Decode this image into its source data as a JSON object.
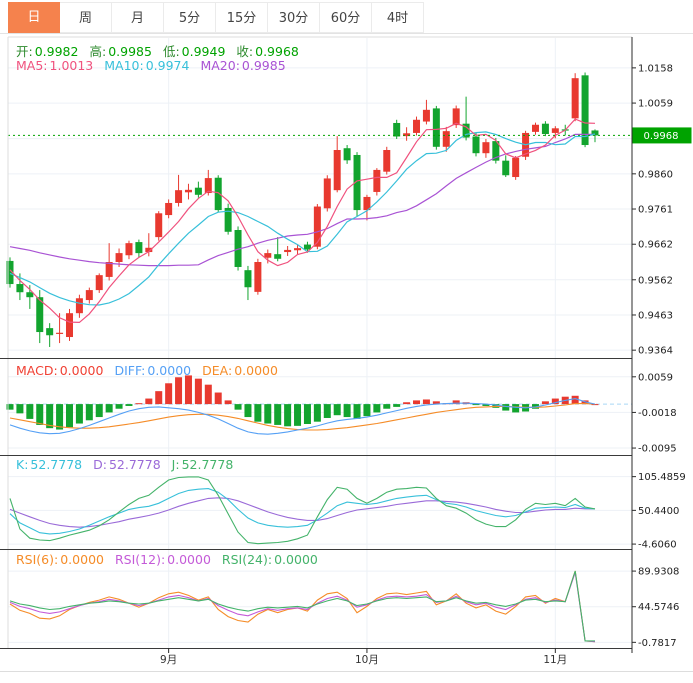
{
  "tabbar": {
    "selected_color": "#f5824d",
    "tabs": [
      {
        "label": "日",
        "name": "tab-day",
        "selected": true
      },
      {
        "label": "周",
        "name": "tab-week",
        "selected": false
      },
      {
        "label": "月",
        "name": "tab-month",
        "selected": false
      },
      {
        "label": "5分",
        "name": "tab-5min",
        "selected": false
      },
      {
        "label": "15分",
        "name": "tab-15min",
        "selected": false
      },
      {
        "label": "30分",
        "name": "tab-30min",
        "selected": false
      },
      {
        "label": "60分",
        "name": "tab-60min",
        "selected": false
      },
      {
        "label": "4时",
        "name": "tab-4hour",
        "selected": false
      }
    ]
  },
  "indicators": {
    "ohlc": {
      "items": [
        {
          "label": "开:",
          "value": "0.9982",
          "color": "#00a300",
          "label_color": "#2e8b2e"
        },
        {
          "label": "高:",
          "value": "0.9985",
          "color": "#00a300",
          "label_color": "#2e8b2e"
        },
        {
          "label": "低:",
          "value": "0.9949",
          "color": "#00a300",
          "label_color": "#2e8b2e"
        },
        {
          "label": "收:",
          "value": "0.9968",
          "color": "#00a300",
          "label_color": "#2e8b2e"
        }
      ]
    },
    "ma": {
      "items": [
        {
          "label": "MA5:",
          "value": "1.0013",
          "color": "#f0527e"
        },
        {
          "label": "MA10:",
          "value": "0.9974",
          "color": "#38c0da"
        },
        {
          "label": "MA20:",
          "value": "0.9985",
          "color": "#a953d4"
        }
      ]
    },
    "macd": {
      "items": [
        {
          "label": "MACD:",
          "value": "0.0000",
          "color": "#f04134"
        },
        {
          "label": "DIFF:",
          "value": "0.0000",
          "color": "#55a0f5"
        },
        {
          "label": "DEA:",
          "value": "0.0000",
          "color": "#f58c28"
        }
      ]
    },
    "kdj": {
      "items": [
        {
          "label": "K:",
          "value": "52.7778",
          "color": "#38c0da"
        },
        {
          "label": "D:",
          "value": "52.7778",
          "color": "#9a6ad8"
        },
        {
          "label": "J:",
          "value": "52.7778",
          "color": "#44b36a"
        }
      ]
    },
    "rsi": {
      "items": [
        {
          "label": "RSI(6):",
          "value": "0.0000",
          "color": "#f58c28"
        },
        {
          "label": "RSI(12):",
          "value": "0.0000",
          "color": "#c45bd8"
        },
        {
          "label": "RSI(24):",
          "value": "0.0000",
          "color": "#44b36a"
        }
      ]
    }
  },
  "chart_data": {
    "type": "candlestick+indicators",
    "x_labels": [
      {
        "index": 16,
        "label": "9月"
      },
      {
        "index": 36,
        "label": "10月"
      },
      {
        "index": 55,
        "label": "11月"
      }
    ],
    "current_price": {
      "value": 0.9968,
      "label": "0.9968"
    },
    "colors": {
      "up": "#e8392f",
      "down": "#12a42e",
      "ma5": "#f0527e",
      "ma10": "#38c0da",
      "ma20": "#a953d4",
      "diff": "#55a0f5",
      "dea": "#f58c28",
      "k": "#38c0da",
      "d": "#9a6ad8",
      "j": "#44b36a",
      "rsi6": "#f58c28",
      "rsi12": "#c45bd8",
      "rsi24": "#44b36a",
      "badge": "#00a300",
      "grid": "#edf1f6",
      "axis": "#2b2b2b",
      "zero_dash": "#a9d6f5",
      "sep": "#3a3a3a"
    },
    "panes": {
      "price": {
        "yticks": [
          "1.0158",
          "1.0059",
          "0.9860",
          "0.9761",
          "0.9662",
          "0.9562",
          "0.9463",
          "0.9364"
        ],
        "grid_extra": [
          0.9959
        ],
        "ylim": [
          0.9342,
          1.0242
        ]
      },
      "macd": {
        "yticks": [
          "0.0059",
          "-0.0018",
          "-0.0095"
        ],
        "ylim": [
          -0.011,
          0.0091
        ],
        "zero_line": true
      },
      "kdj": {
        "yticks": [
          "105.4859",
          "50.4400",
          "-4.6060"
        ],
        "ylim": [
          -11.0,
          135.9
        ]
      },
      "rsi": {
        "yticks": [
          "89.9308",
          "44.5746",
          "-0.7817"
        ],
        "ylim": [
          -8.0,
          115.5
        ]
      }
    },
    "candles": [
      [
        0.9615,
        0.9625,
        0.954,
        0.955
      ],
      [
        0.955,
        0.958,
        0.9505,
        0.9527
      ],
      [
        0.9527,
        0.9547,
        0.948,
        0.9513
      ],
      [
        0.9513,
        0.9533,
        0.9384,
        0.9415
      ],
      [
        0.9426,
        0.944,
        0.9373,
        0.9406
      ],
      [
        0.9412,
        0.9468,
        0.9384,
        0.9413
      ],
      [
        0.9401,
        0.948,
        0.939,
        0.9468
      ],
      [
        0.9468,
        0.952,
        0.9455,
        0.951
      ],
      [
        0.9505,
        0.954,
        0.9495,
        0.9533
      ],
      [
        0.9533,
        0.958,
        0.9525,
        0.9575
      ],
      [
        0.957,
        0.9665,
        0.956,
        0.9612
      ],
      [
        0.9612,
        0.965,
        0.9598,
        0.9637
      ],
      [
        0.9631,
        0.9672,
        0.962,
        0.9665
      ],
      [
        0.9668,
        0.9675,
        0.9625,
        0.9637
      ],
      [
        0.964,
        0.9693,
        0.9628,
        0.9652
      ],
      [
        0.9682,
        0.9755,
        0.9672,
        0.9749
      ],
      [
        0.9744,
        0.9788,
        0.9735,
        0.9778
      ],
      [
        0.9778,
        0.9857,
        0.9768,
        0.9814
      ],
      [
        0.9808,
        0.9832,
        0.9788,
        0.9815
      ],
      [
        0.9821,
        0.9838,
        0.9793,
        0.9801
      ],
      [
        0.9806,
        0.9871,
        0.9799,
        0.9848
      ],
      [
        0.9849,
        0.9856,
        0.9752,
        0.9758
      ],
      [
        0.9764,
        0.9776,
        0.9689,
        0.9697
      ],
      [
        0.9702,
        0.9712,
        0.9588,
        0.9598
      ],
      [
        0.9589,
        0.9601,
        0.9505,
        0.9541
      ],
      [
        0.9528,
        0.9621,
        0.952,
        0.9612
      ],
      [
        0.9624,
        0.9647,
        0.9608,
        0.9637
      ],
      [
        0.9634,
        0.9682,
        0.9614,
        0.9621
      ],
      [
        0.964,
        0.9657,
        0.9629,
        0.9646
      ],
      [
        0.9645,
        0.9662,
        0.9634,
        0.9651
      ],
      [
        0.9661,
        0.9669,
        0.9638,
        0.9647
      ],
      [
        0.9655,
        0.9775,
        0.9648,
        0.9768
      ],
      [
        0.9763,
        0.9856,
        0.9754,
        0.9847
      ],
      [
        0.9814,
        0.9966,
        0.9808,
        0.9927
      ],
      [
        0.9932,
        0.9941,
        0.9888,
        0.9898
      ],
      [
        0.9913,
        0.9921,
        0.9739,
        0.9758
      ],
      [
        0.9758,
        0.9801,
        0.9729,
        0.9795
      ],
      [
        0.9809,
        0.9876,
        0.9799,
        0.9871
      ],
      [
        0.9866,
        0.9936,
        0.9858,
        0.9927
      ],
      [
        1.0003,
        1.0012,
        0.9958,
        0.9965
      ],
      [
        0.9966,
        0.9991,
        0.9953,
        0.9974
      ],
      [
        0.9975,
        1.0021,
        0.9968,
        1.0012
      ],
      [
        1.0007,
        1.0068,
        0.9999,
        1.004
      ],
      [
        1.0044,
        1.0051,
        0.9928,
        0.9936
      ],
      [
        0.9936,
        0.9992,
        0.9922,
        0.998
      ],
      [
        0.9997,
        1.0052,
        0.9989,
        1.0044
      ],
      [
        1.0001,
        1.0077,
        0.9954,
        0.9962
      ],
      [
        0.9965,
        0.9976,
        0.9909,
        0.9918
      ],
      [
        0.9918,
        0.9958,
        0.9905,
        0.9949
      ],
      [
        0.9952,
        0.9961,
        0.9889,
        0.9897
      ],
      [
        0.9897,
        0.9912,
        0.9851,
        0.9856
      ],
      [
        0.9851,
        0.991,
        0.9843,
        0.9905
      ],
      [
        0.9908,
        0.9981,
        0.9899,
        0.9975
      ],
      [
        0.9978,
        1.0004,
        0.997,
        0.9998
      ],
      [
        1.0001,
        1.0008,
        0.9966,
        0.9972
      ],
      [
        0.9975,
        0.9994,
        0.996,
        0.9988
      ],
      [
        0.9985,
        0.9998,
        0.9968,
        0.9984
      ],
      [
        1.0016,
        1.0143,
        1.0008,
        1.0129
      ],
      [
        1.0137,
        1.0145,
        0.9935,
        0.9941
      ],
      [
        0.9982,
        0.9985,
        0.9949,
        0.9968
      ]
    ],
    "series": {
      "ma5": [
        0.959,
        0.956,
        0.9535,
        0.9505,
        0.9482,
        0.9455,
        0.9443,
        0.9442,
        0.9466,
        0.95,
        0.954,
        0.9573,
        0.9604,
        0.9625,
        0.9641,
        0.9668,
        0.9696,
        0.9726,
        0.9762,
        0.9791,
        0.9811,
        0.9807,
        0.9784,
        0.974,
        0.9688,
        0.9641,
        0.9617,
        0.9602,
        0.9611,
        0.9633,
        0.964,
        0.9667,
        0.9712,
        0.9768,
        0.9817,
        0.984,
        0.9845,
        0.985,
        0.985,
        0.9863,
        0.9906,
        0.995,
        0.9984,
        0.9985,
        0.9988,
        1.0002,
        0.9992,
        0.9968,
        0.9971,
        0.9954,
        0.9916,
        0.9905,
        0.9916,
        0.9926,
        0.9941,
        0.9968,
        0.9983,
        1.0014,
        1.0003,
        1.0002
      ],
      "ma10": [
        0.958,
        0.9568,
        0.9556,
        0.954,
        0.9524,
        0.9512,
        0.9503,
        0.9496,
        0.9492,
        0.9491,
        0.9497,
        0.9508,
        0.9523,
        0.9546,
        0.957,
        0.9604,
        0.9635,
        0.9665,
        0.9693,
        0.9716,
        0.974,
        0.9752,
        0.9755,
        0.9751,
        0.974,
        0.9726,
        0.9712,
        0.9693,
        0.9676,
        0.9661,
        0.9641,
        0.9642,
        0.9657,
        0.969,
        0.9725,
        0.974,
        0.9756,
        0.9781,
        0.9809,
        0.984,
        0.9873,
        0.9897,
        0.9917,
        0.9918,
        0.9926,
        0.9954,
        0.9971,
        0.9976,
        0.9978,
        0.9971,
        0.9959,
        0.9949,
        0.9942,
        0.9948,
        0.9948,
        0.9942,
        0.9944,
        0.9965,
        0.9965,
        0.9972
      ],
      "ma20": [
        0.9655,
        0.965,
        0.9645,
        0.9638,
        0.9632,
        0.9626,
        0.9621,
        0.9617,
        0.9613,
        0.961,
        0.9608,
        0.9606,
        0.9604,
        0.9603,
        0.9602,
        0.9602,
        0.9602,
        0.9603,
        0.9603,
        0.9604,
        0.9618,
        0.963,
        0.9639,
        0.9648,
        0.9655,
        0.9665,
        0.9673,
        0.9679,
        0.9685,
        0.9688,
        0.969,
        0.9697,
        0.9706,
        0.972,
        0.9733,
        0.9733,
        0.9734,
        0.9737,
        0.9742,
        0.9751,
        0.9757,
        0.977,
        0.9787,
        0.9804,
        0.9826,
        0.9847,
        0.9863,
        0.9878,
        0.9893,
        0.9906,
        0.9916,
        0.9923,
        0.9929,
        0.9933,
        0.9937,
        0.9948,
        0.9958,
        0.9971,
        0.9971,
        0.9971
      ],
      "macd_hist": [
        -0.0012,
        -0.002,
        -0.0032,
        -0.0045,
        -0.0052,
        -0.0055,
        -0.005,
        -0.0042,
        -0.0035,
        -0.0028,
        -0.0018,
        -0.001,
        -0.0004,
        0.0002,
        0.0012,
        0.0028,
        0.0045,
        0.0058,
        0.0062,
        0.0055,
        0.0042,
        0.0025,
        0.0008,
        -0.0012,
        -0.0028,
        -0.0038,
        -0.0042,
        -0.0045,
        -0.0048,
        -0.0047,
        -0.0043,
        -0.0038,
        -0.003,
        -0.0024,
        -0.0028,
        -0.0032,
        -0.0026,
        -0.0018,
        -0.001,
        -0.0006,
        0.0004,
        0.0008,
        0.001,
        0.0006,
        0.0002,
        0.0008,
        0.0004,
        -0.0002,
        -0.0004,
        -0.0008,
        -0.0014,
        -0.0018,
        -0.0016,
        -0.001,
        0.0006,
        0.0012,
        0.0016,
        0.0018,
        0.0008,
        0.0
      ],
      "diff": [
        -0.0045,
        -0.0052,
        -0.0058,
        -0.0062,
        -0.0064,
        -0.0063,
        -0.0059,
        -0.0053,
        -0.0046,
        -0.0038,
        -0.003,
        -0.0022,
        -0.0015,
        -0.001,
        -0.0007,
        -0.0006,
        -0.0008,
        -0.001,
        -0.0013,
        -0.0018,
        -0.0024,
        -0.0032,
        -0.0042,
        -0.0052,
        -0.006,
        -0.0064,
        -0.0065,
        -0.0063,
        -0.006,
        -0.0056,
        -0.0052,
        -0.0047,
        -0.0041,
        -0.0036,
        -0.0033,
        -0.0031,
        -0.0028,
        -0.0024,
        -0.0019,
        -0.0014,
        -0.0009,
        -0.0005,
        -0.0002,
        0.0,
        0.0001,
        0.0002,
        0.0002,
        0.0001,
        0.0,
        -0.0002,
        -0.0005,
        -0.0007,
        -0.0008,
        -0.0006,
        -0.0002,
        0.0003,
        0.0008,
        0.0012,
        0.0005,
        0.0
      ],
      "dea": [
        -0.003,
        -0.0034,
        -0.0038,
        -0.0042,
        -0.0046,
        -0.0049,
        -0.0051,
        -0.0052,
        -0.0052,
        -0.0051,
        -0.0049,
        -0.0046,
        -0.0043,
        -0.004,
        -0.0036,
        -0.0032,
        -0.0028,
        -0.0025,
        -0.0023,
        -0.0022,
        -0.0022,
        -0.0024,
        -0.0027,
        -0.0031,
        -0.0036,
        -0.0041,
        -0.0046,
        -0.005,
        -0.0053,
        -0.0055,
        -0.0056,
        -0.0056,
        -0.0055,
        -0.0053,
        -0.0051,
        -0.0048,
        -0.0045,
        -0.0042,
        -0.0038,
        -0.0034,
        -0.003,
        -0.0026,
        -0.0022,
        -0.0018,
        -0.0015,
        -0.0012,
        -0.0009,
        -0.0007,
        -0.0006,
        -0.0005,
        -0.0005,
        -0.0006,
        -0.0007,
        -0.0007,
        -0.0006,
        -0.0004,
        -0.0002,
        0.0001,
        0.0001,
        0.0
      ],
      "k": [
        45,
        30,
        22,
        14,
        12,
        13,
        16,
        20,
        26,
        33,
        40,
        46,
        52,
        55,
        57,
        62,
        70,
        78,
        83,
        85,
        86,
        80,
        68,
        52,
        38,
        30,
        26,
        24,
        23,
        24,
        26,
        35,
        46,
        58,
        64,
        62,
        60,
        62,
        66,
        70,
        72,
        74,
        75,
        68,
        62,
        60,
        56,
        50,
        46,
        42,
        40,
        42,
        48,
        54,
        55,
        56,
        55,
        60,
        54,
        52.78
      ],
      "d": [
        52,
        46,
        40,
        34,
        29,
        26,
        24,
        23,
        24,
        26,
        29,
        32,
        36,
        39,
        42,
        46,
        51,
        57,
        62,
        66,
        70,
        71,
        70,
        66,
        60,
        54,
        48,
        43,
        39,
        36,
        34,
        34,
        37,
        42,
        47,
        51,
        53,
        55,
        57,
        60,
        62,
        64,
        66,
        66,
        65,
        64,
        62,
        59,
        56,
        52,
        49,
        47,
        47,
        49,
        51,
        52,
        52,
        54,
        53,
        52.78
      ],
      "j": [
        70,
        20,
        5,
        2,
        1,
        5,
        10,
        14,
        18,
        25,
        35,
        48,
        60,
        70,
        75,
        88,
        100,
        104,
        105,
        105,
        100,
        75,
        45,
        15,
        -2,
        -4,
        -3,
        -2,
        0,
        4,
        10,
        40,
        68,
        88,
        85,
        70,
        62,
        70,
        80,
        85,
        86,
        88,
        87,
        70,
        58,
        54,
        46,
        35,
        28,
        24,
        24,
        35,
        52,
        62,
        60,
        62,
        58,
        70,
        56,
        52.78
      ],
      "rsi6": [
        48,
        40,
        36,
        30,
        29,
        33,
        41,
        46,
        50,
        53,
        57,
        54,
        49,
        44,
        49,
        56,
        61,
        63,
        59,
        53,
        57,
        41,
        32,
        27,
        25,
        35,
        41,
        37,
        41,
        43,
        39,
        53,
        61,
        63,
        55,
        37,
        45,
        55,
        61,
        62,
        60,
        62,
        64,
        47,
        52,
        61,
        49,
        43,
        47,
        39,
        35,
        45,
        57,
        59,
        49,
        55,
        51,
        90,
        1,
        0
      ],
      "rsi12": [
        50,
        45,
        42,
        38,
        36,
        38,
        42,
        46,
        49,
        51,
        54,
        52,
        49,
        46,
        49,
        53,
        57,
        59,
        56,
        52,
        55,
        46,
        40,
        35,
        33,
        38,
        42,
        40,
        42,
        43,
        41,
        49,
        55,
        58,
        53,
        44,
        47,
        53,
        57,
        58,
        57,
        58,
        60,
        50,
        52,
        58,
        51,
        47,
        49,
        44,
        41,
        47,
        54,
        56,
        50,
        53,
        51,
        88,
        1,
        0
      ],
      "rsi24": [
        52,
        48,
        46,
        43,
        41,
        42,
        45,
        47,
        49,
        50,
        52,
        51,
        49,
        48,
        49,
        52,
        54,
        56,
        54,
        52,
        54,
        48,
        44,
        41,
        39,
        42,
        44,
        43,
        44,
        45,
        43,
        48,
        52,
        55,
        52,
        46,
        48,
        52,
        55,
        56,
        55,
        56,
        57,
        51,
        52,
        56,
        52,
        49,
        50,
        47,
        45,
        48,
        53,
        54,
        51,
        52,
        51,
        90,
        1,
        1
      ]
    }
  }
}
